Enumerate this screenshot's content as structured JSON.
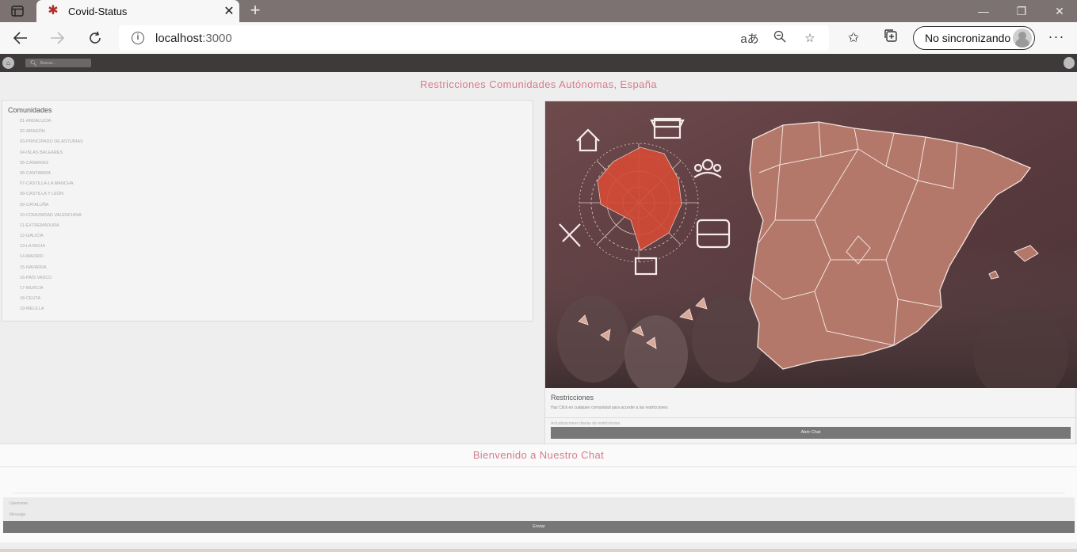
{
  "browser": {
    "tab_title": "Covid-Status",
    "url_host": "localhost",
    "url_port": ":3000",
    "sync_label": "No sincronizando"
  },
  "appbar": {
    "search_placeholder": "Buscar..."
  },
  "page": {
    "title": "Restricciones Comunidades Autónomas, España"
  },
  "communities": {
    "title": "Comunidades",
    "items": [
      "01-ANDALUCÍA",
      "02-ARAGÓN",
      "03-PRINCIPADO DE ASTURIAS",
      "04-ISLAS BALEARES",
      "05-CANARIAS",
      "06-CANTABRIA",
      "07-CASTILLA-LA MANCHA",
      "08-CASTILLA Y LEÓN",
      "09-CATALUÑA",
      "10-COMUNIDAD VALENCIANA",
      "11-EXTREMADURA",
      "12-GALICIA",
      "13-LA RIOJA",
      "14-MADRID",
      "15-NAVARRA",
      "16-PAÍS VASCO",
      "17-MURCIA",
      "18-CEUTA",
      "19-MELILLA"
    ]
  },
  "restrictions": {
    "title": "Restricciones",
    "description": "Haz Click en cualquier comunidad para acceder a las restricciones",
    "update_label": "Actualizaciones diarias de restricciones",
    "open_chat_label": "Abrir Chat"
  },
  "chat": {
    "title": "Bienvenido a Nuestro Chat",
    "username_placeholder": "Username",
    "message_placeholder": "Message",
    "send_label": "Enviar"
  },
  "colors": {
    "accent": "#d67b8e",
    "button": "#777777",
    "appbar": "#3e3a3a"
  }
}
